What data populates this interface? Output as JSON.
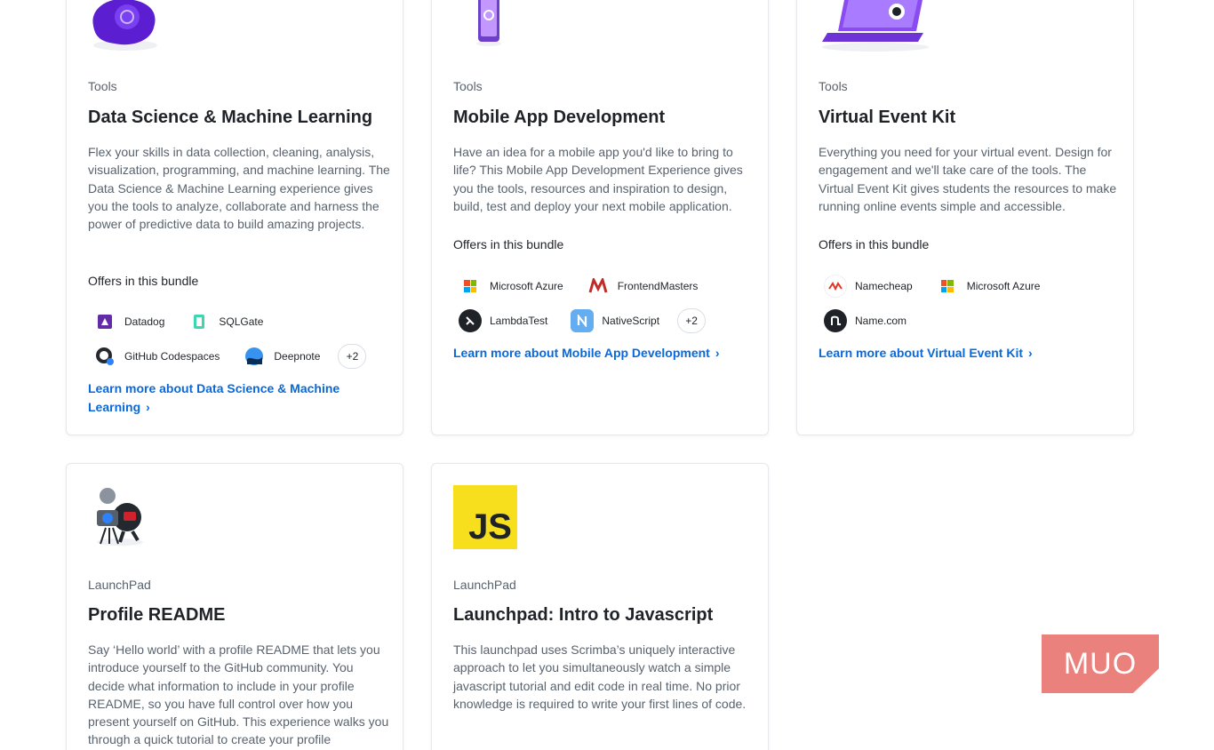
{
  "cards": [
    {
      "category": "Tools",
      "title": "Data Science & Machine Learning",
      "description": "Flex your skills in data collection, cleaning, analysis, visualization, programming, and machine learning. The Data Science & Machine Learning experience gives you the tools to analyze, collaborate and harness the power of predictive data to build amazing projects.",
      "offers_label": "Offers in this bundle",
      "offers": [
        "Datadog",
        "SQLGate",
        "GitHub Codespaces",
        "Deepnote"
      ],
      "more_count": "+2",
      "learn_more": "Learn more about Data Science & Machine Learning"
    },
    {
      "category": "Tools",
      "title": "Mobile App Development",
      "description": "Have an idea for a mobile app you'd like to bring to life? This Mobile App Development Experience gives you the tools, resources and inspiration to design, build, test and deploy your next mobile application.",
      "offers_label": "Offers in this bundle",
      "offers": [
        "Microsoft Azure",
        "FrontendMasters",
        "LambdaTest",
        "NativeScript"
      ],
      "more_count": "+2",
      "learn_more": "Learn more about Mobile App Development"
    },
    {
      "category": "Tools",
      "title": "Virtual Event Kit",
      "description": "Everything you need for your virtual event. Design for engagement and we'll take care of the tools. The Virtual Event Kit gives students the resources to make running online events simple and accessible.",
      "offers_label": "Offers in this bundle",
      "offers": [
        "Namecheap",
        "Microsoft Azure",
        "Name.com"
      ],
      "learn_more": "Learn more about Virtual Event Kit"
    },
    {
      "category": "LaunchPad",
      "title": "Profile README",
      "description": "Say ‘Hello world’ with a profile README that lets you introduce yourself to the GitHub community. You decide what information to include in your profile README, so you have full control over how you present yourself on GitHub. This experience walks you through a quick tutorial to create your profile"
    },
    {
      "category": "LaunchPad",
      "title": "Launchpad: Intro to Javascript",
      "description": "This launchpad uses Scrimba’s uniquely interactive approach to let you simultaneously watch a simple javascript tutorial and edit code in real time. No prior knowledge is required to write your first lines of code.",
      "js_logo_text": "JS"
    }
  ],
  "watermark": "MUO",
  "colors": {
    "link": "#0969da",
    "muted_text": "#59636e",
    "js_yellow": "#f7df1e",
    "watermark": "#e8706b"
  }
}
